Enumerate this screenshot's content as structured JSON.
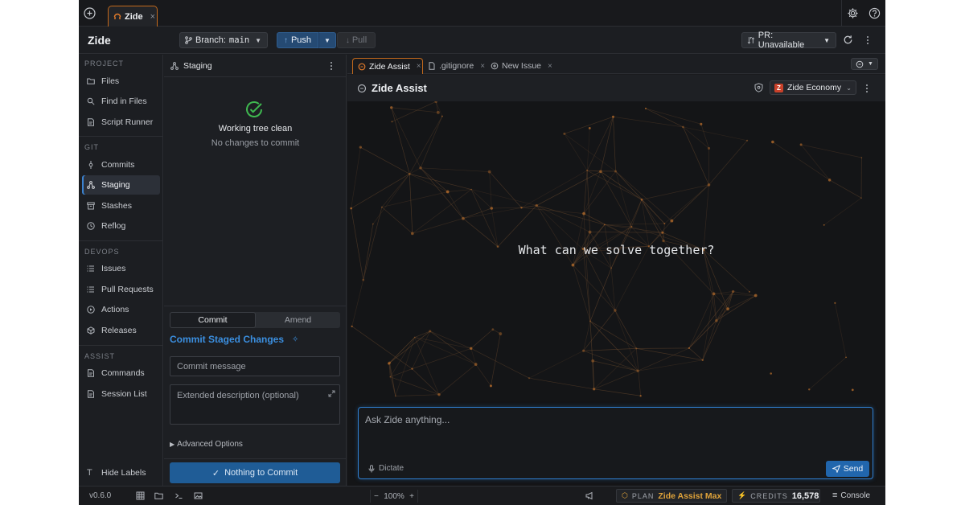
{
  "titlebar": {
    "app_tab": "Zide"
  },
  "toolbar": {
    "brand": "Zide",
    "branch_prefix": "Branch:",
    "branch_name": "main",
    "push_label": "Push",
    "pull_label": "Pull",
    "pr_label": "PR: Unavailable"
  },
  "sidebar": {
    "sections": [
      {
        "title": "PROJECT",
        "items": [
          "Files",
          "Find in Files",
          "Script Runner"
        ]
      },
      {
        "title": "GIT",
        "items": [
          "Commits",
          "Staging",
          "Stashes",
          "Reflog"
        ]
      },
      {
        "title": "DEVOPS",
        "items": [
          "Issues",
          "Pull Requests",
          "Actions",
          "Releases"
        ]
      },
      {
        "title": "ASSIST",
        "items": [
          "Commands",
          "Session List"
        ]
      }
    ],
    "active_item": "Staging",
    "hide_labels": "Hide Labels"
  },
  "staging": {
    "title": "Staging",
    "clean_title": "Working tree clean",
    "clean_subtitle": "No changes to commit",
    "seg_commit": "Commit",
    "seg_amend": "Amend",
    "commit_heading": "Commit Staged Changes",
    "message_placeholder": "Commit message",
    "description_placeholder": "Extended description (optional)",
    "advanced": "Advanced Options",
    "nothing_button": "Nothing to Commit"
  },
  "tabs": [
    {
      "label": "Zide Assist",
      "active": true,
      "icon": "assist-icon"
    },
    {
      "label": ".gitignore",
      "active": false,
      "icon": "file-icon"
    },
    {
      "label": "New Issue",
      "active": false,
      "icon": "issue-icon"
    }
  ],
  "assist": {
    "title": "Zide Assist",
    "model": "Zide Economy",
    "hero": "What can we solve together?",
    "input_placeholder": "Ask Zide anything...",
    "dictate": "Dictate",
    "send": "Send"
  },
  "statusbar": {
    "version": "v0.6.0",
    "zoom": "100%",
    "plan_label": "PLAN",
    "plan_value": "Zide Assist Max",
    "credits_label": "CREDITS",
    "credits_value": "16,578",
    "console": "Console"
  },
  "colors": {
    "accent_blue": "#3b8fe0",
    "accent_orange": "#c46a1c",
    "success_green": "#3fb950",
    "plan_gold": "#e0a33a"
  }
}
